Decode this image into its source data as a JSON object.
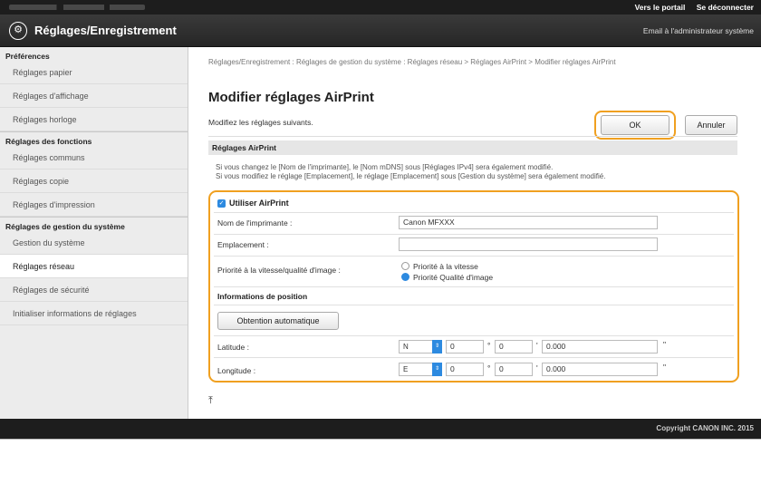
{
  "topbar": {
    "portal_link": "Vers le portail",
    "logout_link": "Se déconnecter"
  },
  "header": {
    "title": "Réglages/Enregistrement",
    "email_admin": "Email à l'administrateur système"
  },
  "sidebar": {
    "groups": [
      {
        "title": "Préférences",
        "items": [
          "Réglages papier",
          "Réglages d'affichage",
          "Réglages horloge"
        ]
      },
      {
        "title": "Réglages des fonctions",
        "items": [
          "Réglages communs",
          "Réglages copie",
          "Réglages d'impression"
        ]
      },
      {
        "title": "Réglages de gestion du système",
        "items": [
          "Gestion du système",
          "Réglages réseau",
          "Réglages de sécurité",
          "Initialiser informations de réglages"
        ]
      }
    ],
    "active_item": "Réglages réseau"
  },
  "main": {
    "breadcrumb": "Réglages/Enregistrement : Réglages de gestion du système : Réglages réseau > Réglages AirPrint > Modifier réglages AirPrint",
    "page_title": "Modifier réglages AirPrint",
    "instruction": "Modifiez les réglages suivants.",
    "ok_label": "OK",
    "cancel_label": "Annuler",
    "section_title": "Réglages AirPrint",
    "note_line1": "Si vous changez le [Nom de l'imprimante], le [Nom mDNS] sous [Réglages IPv4] sera également modifié.",
    "note_line2": "Si vous modifiez le réglage [Emplacement], le réglage [Emplacement] sous [Gestion du système] sera également modifié.",
    "use_airprint_label": "Utiliser AirPrint",
    "use_airprint_checked": true,
    "printer_name_label": "Nom de l'imprimante :",
    "printer_name_value": "Canon MFXXX",
    "location_label": "Emplacement :",
    "location_value": "",
    "priority_label": "Priorité à la vitesse/qualité d'image :",
    "priority_options": [
      "Priorité à la vitesse",
      "Priorité Qualité d'image"
    ],
    "priority_selected": "Priorité Qualité d'image",
    "position_header": "Informations de position",
    "auto_button": "Obtention automatique",
    "latitude_label": "Latitude :",
    "latitude": {
      "dir": "N",
      "deg": "0",
      "min": "0",
      "sec": "0.000"
    },
    "longitude_label": "Longitude :",
    "longitude": {
      "dir": "E",
      "deg": "0",
      "min": "0",
      "sec": "0.000"
    },
    "deg_symbol": "°",
    "min_symbol": "'",
    "sec_symbol": "\"",
    "top_icon": "⤒"
  },
  "footer": {
    "copyright": "Copyright CANON INC. 2015"
  },
  "colors": {
    "highlight": "#f0a020",
    "accent": "#2d8ae0",
    "dark_bar": "#1d1d1d"
  }
}
